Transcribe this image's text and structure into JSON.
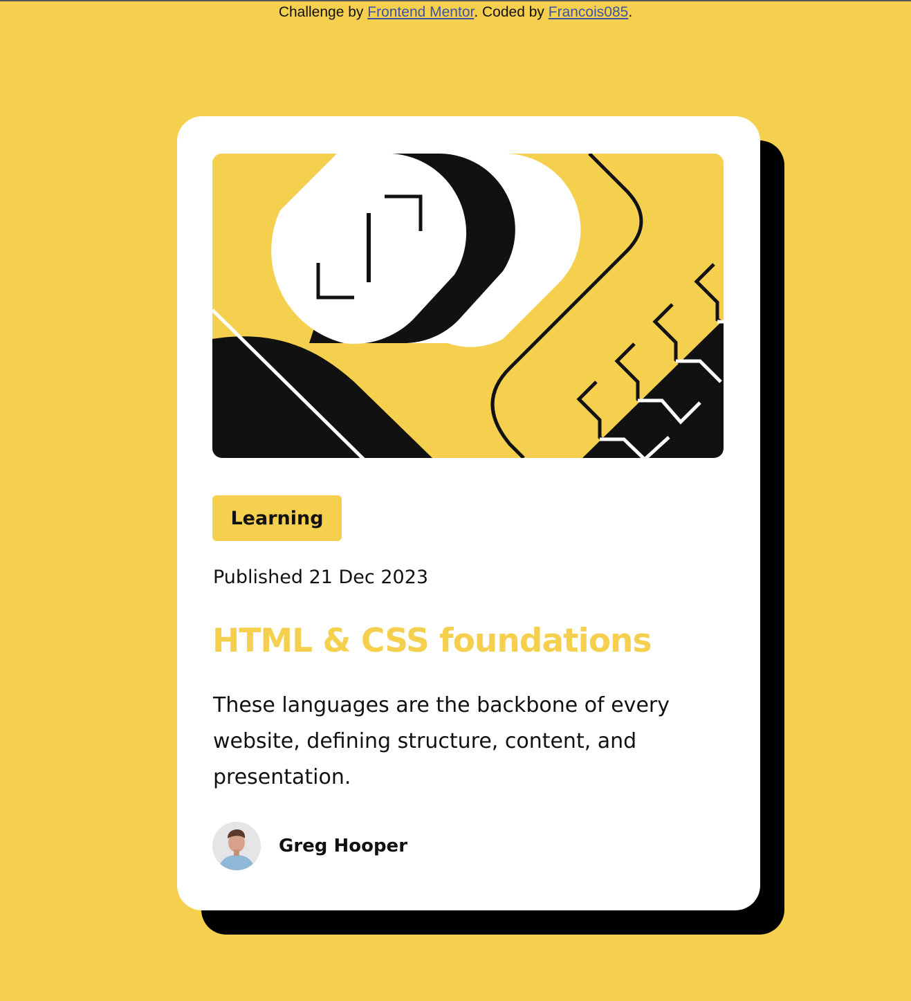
{
  "attribution": {
    "prefix": "Challenge by ",
    "challenge_link": "Frontend Mentor",
    "middle": ". Coded by ",
    "author_link": "Francois085",
    "suffix": "."
  },
  "card": {
    "category": "Learning",
    "published": "Published 21 Dec 2023",
    "title": "HTML & CSS foundations",
    "description": "These languages are the backbone of every website, defining structure, content, and presentation.",
    "author_name": "Greg Hooper",
    "hero_image_icon": "illustration-article",
    "avatar_icon": "avatar-photo"
  },
  "colors": {
    "background": "#F4D04E",
    "card": "#FFFFFF",
    "shadow": "#000000",
    "accent": "#F4D04E",
    "text": "#111111",
    "link": "#3E52A3"
  }
}
